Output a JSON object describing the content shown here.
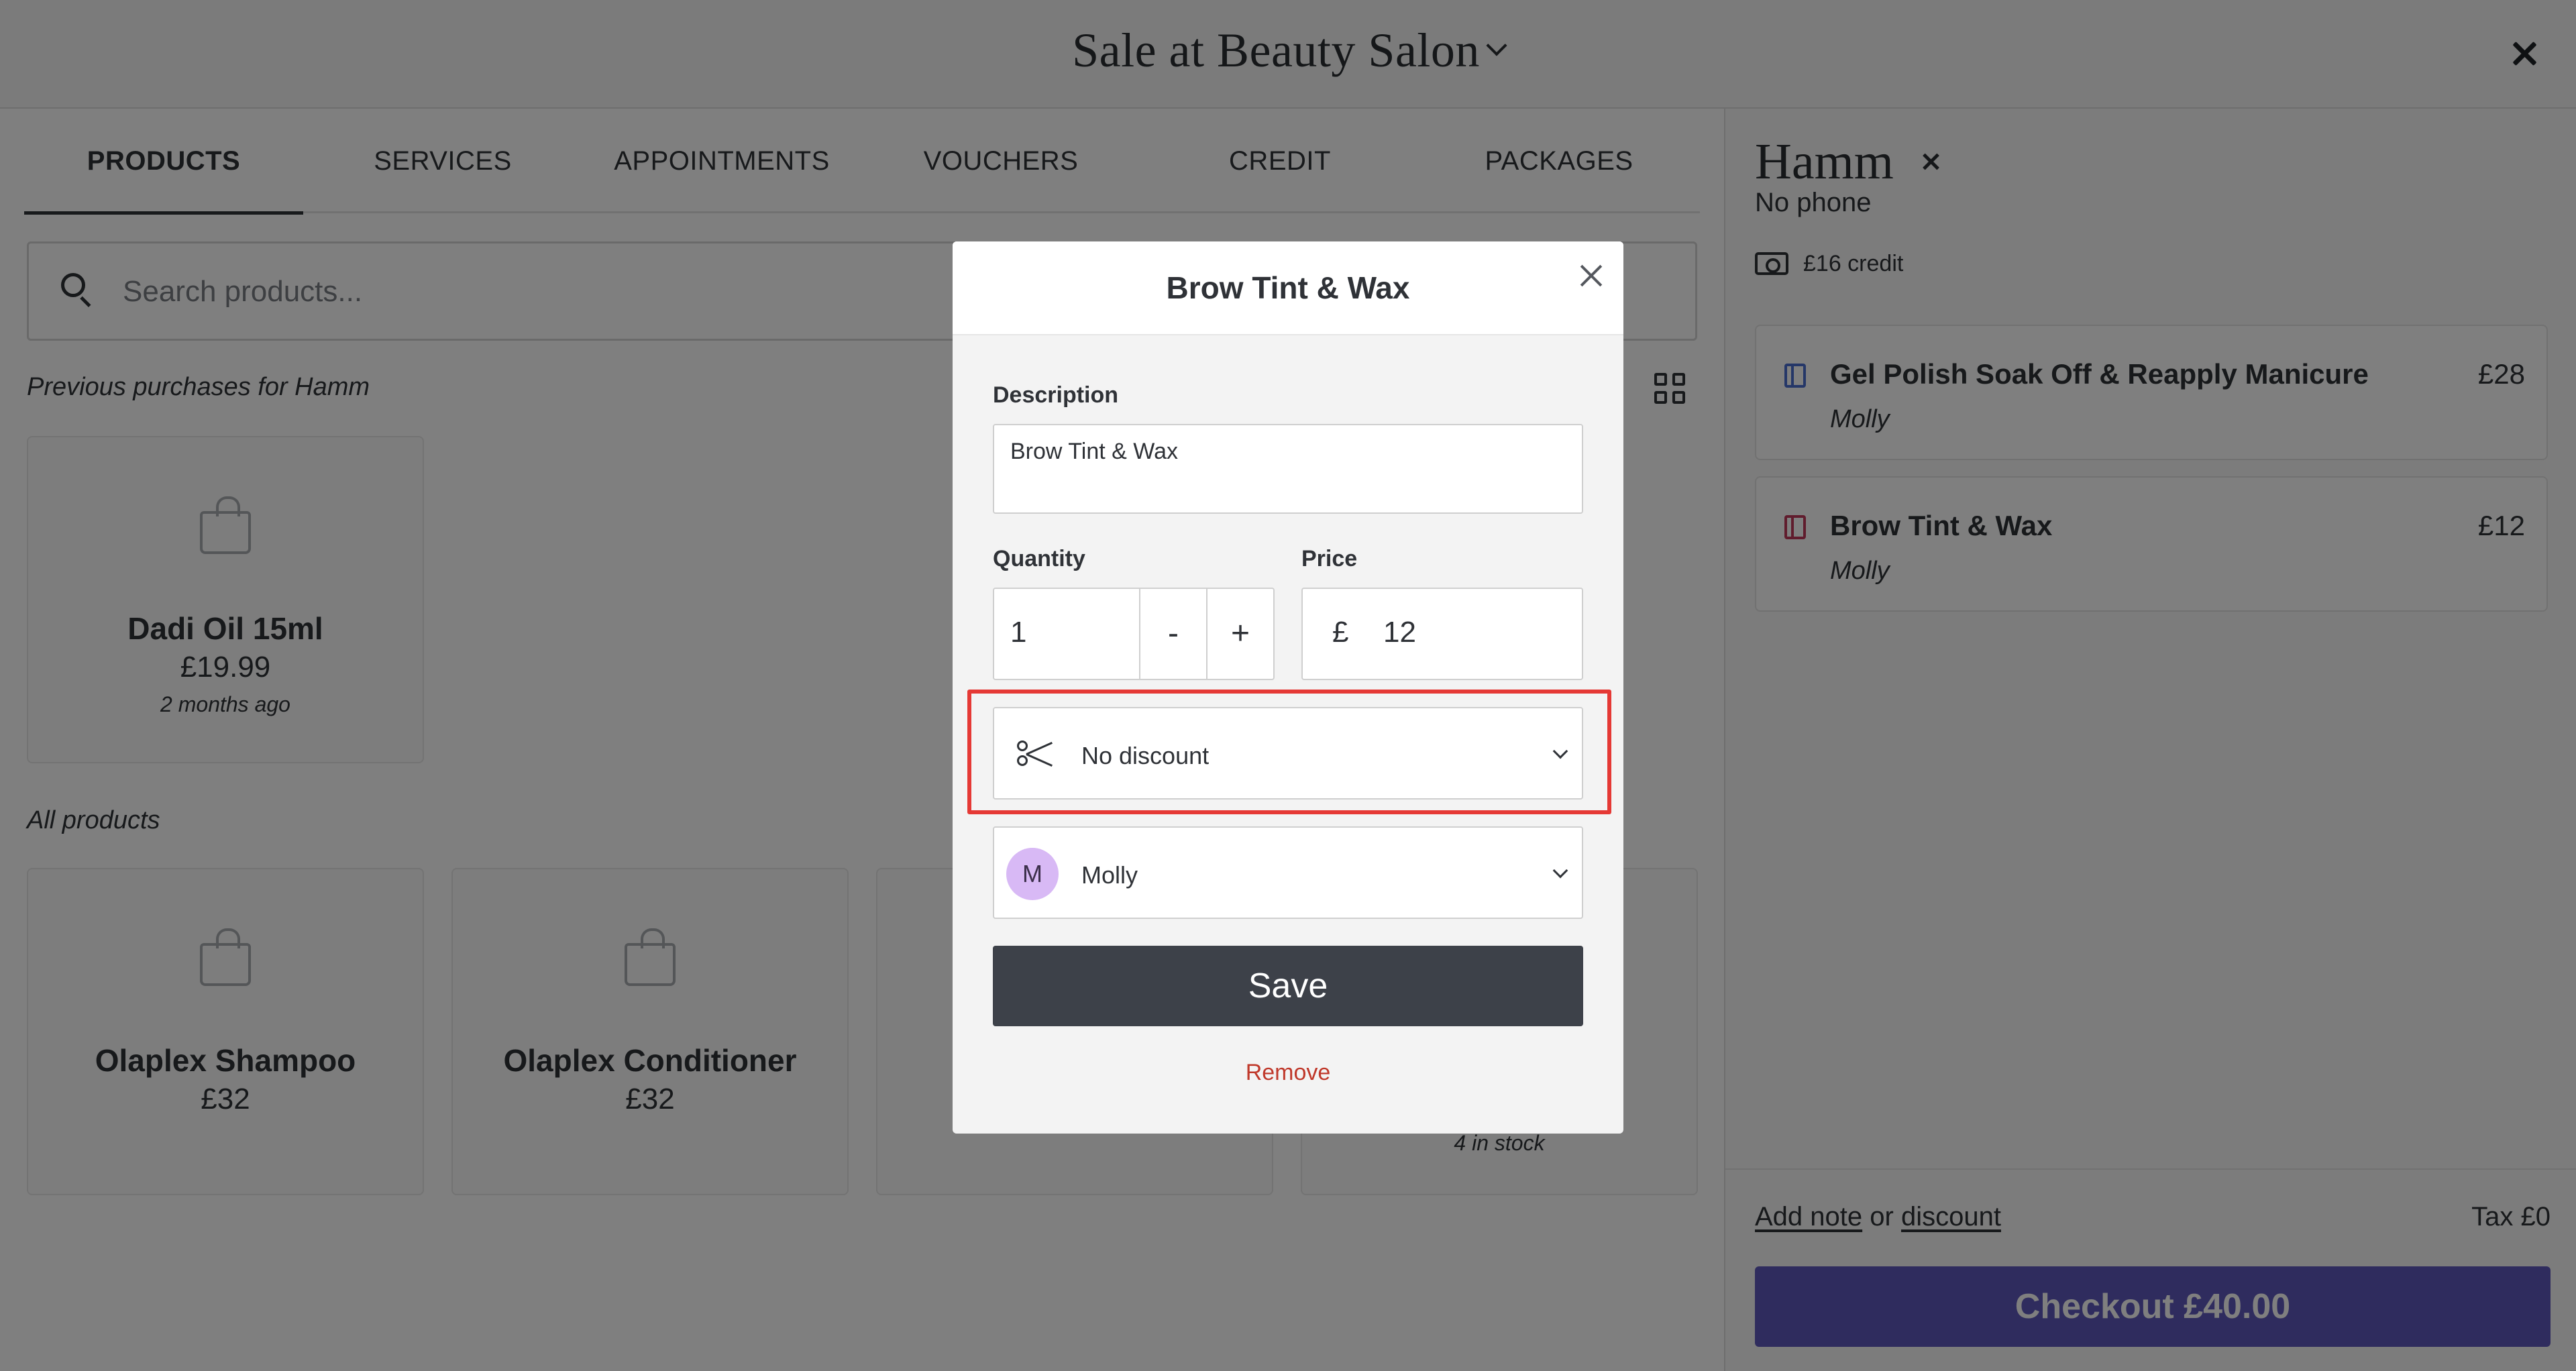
{
  "header": {
    "title": "Sale at Beauty Salon"
  },
  "tabs": [
    {
      "label": "PRODUCTS",
      "active": true
    },
    {
      "label": "SERVICES",
      "active": false
    },
    {
      "label": "APPOINTMENTS",
      "active": false
    },
    {
      "label": "VOUCHERS",
      "active": false
    },
    {
      "label": "CREDIT",
      "active": false
    },
    {
      "label": "PACKAGES",
      "active": false
    }
  ],
  "search": {
    "placeholder": "Search products..."
  },
  "previous_purchases": {
    "label": "Previous purchases for Hamm",
    "items": [
      {
        "name": "Dadi Oil 15ml",
        "price": "£19.99",
        "meta": "2 months ago"
      }
    ]
  },
  "all_products": {
    "label": "All products",
    "items": [
      {
        "name": "Olaplex Shampoo",
        "price": "£32",
        "meta": ""
      },
      {
        "name": "Olaplex Conditioner",
        "price": "£32",
        "meta": ""
      },
      {
        "name": "",
        "price": "",
        "meta": ""
      },
      {
        "name": "",
        "price": "",
        "meta": "4 in stock"
      }
    ]
  },
  "client": {
    "name": "Hamm",
    "phone": "No phone",
    "credit": "£16 credit"
  },
  "cart": {
    "items": [
      {
        "name": "Gel Polish Soak Off & Reapply Manicure",
        "staff": "Molly",
        "price": "£28",
        "marker_color": "#4a6fd0"
      },
      {
        "name": "Brow Tint & Wax",
        "staff": "Molly",
        "price": "£12",
        "marker_color": "#c0395a"
      }
    ]
  },
  "footer": {
    "add_note": "Add note",
    "or": "or",
    "discount": "discount",
    "tax": "Tax £0",
    "checkout": "Checkout £40.00"
  },
  "modal": {
    "title": "Brow Tint & Wax",
    "description_label": "Description",
    "description_value": "Brow Tint & Wax",
    "quantity_label": "Quantity",
    "quantity_value": "1",
    "minus": "-",
    "plus": "+",
    "price_label": "Price",
    "currency": "£",
    "price_value": "12",
    "discount_value": "No discount",
    "staff_initial": "M",
    "staff_value": "Molly",
    "save": "Save",
    "remove": "Remove"
  },
  "colors": {
    "checkout": "#5f59bd",
    "save": "#3d4149",
    "remove": "#c0392b",
    "highlight": "#e53935",
    "avatar": "#d8b9f5"
  }
}
